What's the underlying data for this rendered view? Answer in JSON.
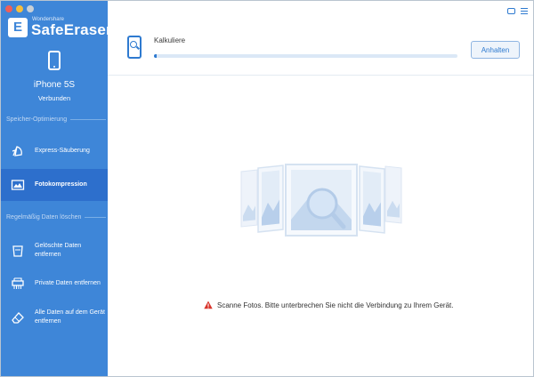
{
  "sidebar": {
    "brand_sub": "Wondershare",
    "brand_name": "SafeEraser",
    "brand_logo_letter": "E",
    "device": {
      "name": "iPhone 5S",
      "status": "Verbunden",
      "icon": "phone-icon"
    },
    "sections": [
      {
        "label": "Speicher-Optimierung",
        "items": [
          {
            "label": "Express-Säuberung",
            "icon": "cleanup-icon",
            "active": false
          },
          {
            "label": "Fotokompression",
            "icon": "photo-icon",
            "active": true
          }
        ]
      },
      {
        "label": "Regelmäßig Daten löschen",
        "items": [
          {
            "label": "Gelöschte Daten entfernen",
            "icon": "trash-icon",
            "active": false
          },
          {
            "label": "Private Daten entfernen",
            "icon": "shredder-icon",
            "active": false
          },
          {
            "label": "Alle Daten auf dem Gerät entfernen",
            "icon": "eraser-icon",
            "active": false
          }
        ]
      }
    ]
  },
  "main": {
    "status_text": "Kalkuliere",
    "progress_percent": 1,
    "stop_label": "Anhalten",
    "warning_text": "Scanne Fotos. Bitte unterbrechen Sie nicht die Verbindung zu Ihrem Gerät."
  },
  "colors": {
    "sidebar_bg": "#3e86d8",
    "active_item": "#2d6fcc",
    "accent": "#2e7ad0",
    "warning": "#d9342b"
  }
}
